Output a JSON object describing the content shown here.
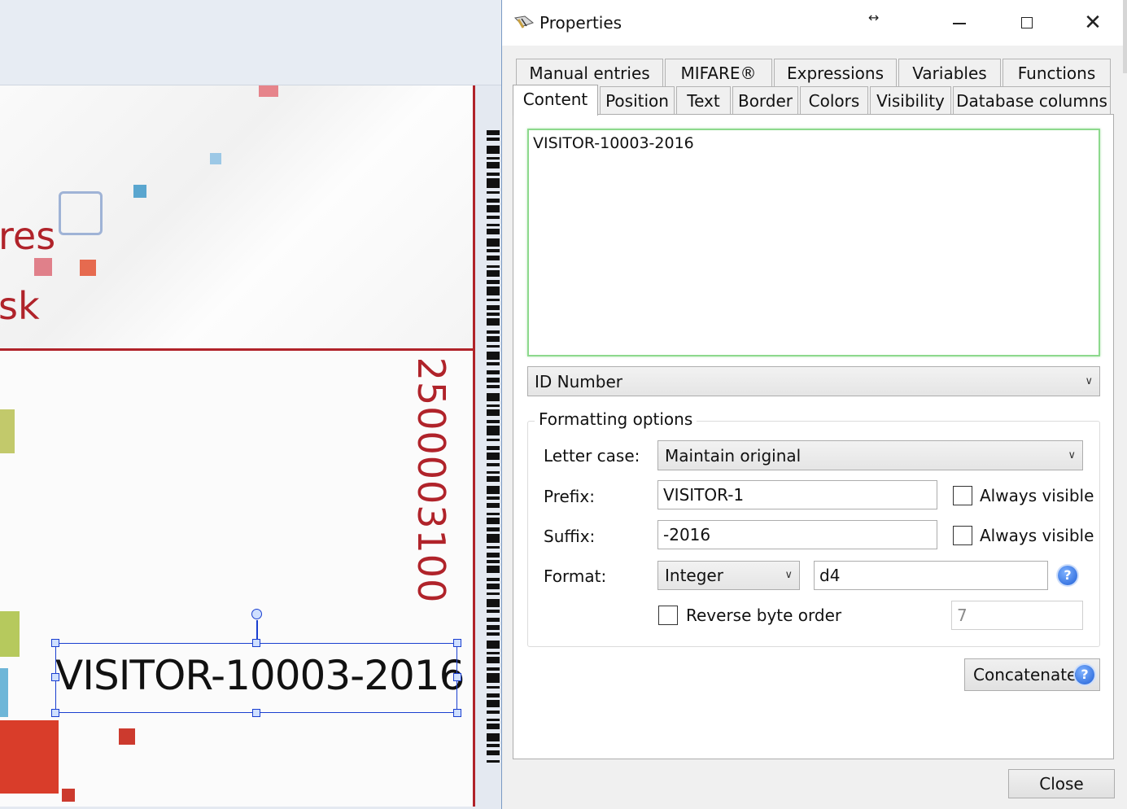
{
  "canvas": {
    "card_words": [
      "res",
      "sk"
    ],
    "card_number": "2500003100",
    "selected_text": "VISITOR-10003-2016"
  },
  "dialog": {
    "title": "Properties",
    "resize_glyph": "↔",
    "tabs_row1": [
      "Manual entries",
      "MIFARE®",
      "Expressions",
      "Variables",
      "Functions"
    ],
    "tabs_row2": [
      "Content",
      "Position",
      "Text",
      "Border",
      "Colors",
      "Visibility",
      "Database columns"
    ],
    "active_tab": "Content",
    "content_value": "VISITOR-10003-2016",
    "source_field": "ID Number",
    "formatting": {
      "legend": "Formatting options",
      "letter_case_label": "Letter case:",
      "letter_case_value": "Maintain original",
      "prefix_label": "Prefix:",
      "prefix_value": "VISITOR-1",
      "suffix_label": "Suffix:",
      "suffix_value": "-2016",
      "always_visible_label": "Always visible",
      "format_label": "Format:",
      "format_type": "Integer",
      "format_string": "d4",
      "reverse_byte_order_label": "Reverse byte order",
      "byte_count": "7"
    },
    "concatenate_label": "Concatenate",
    "close_label": "Close",
    "help_glyph": "?"
  },
  "colors": {
    "card_red": "#b0232a",
    "selection_blue": "#1a3fd0",
    "focus_green": "#8dd98d"
  }
}
